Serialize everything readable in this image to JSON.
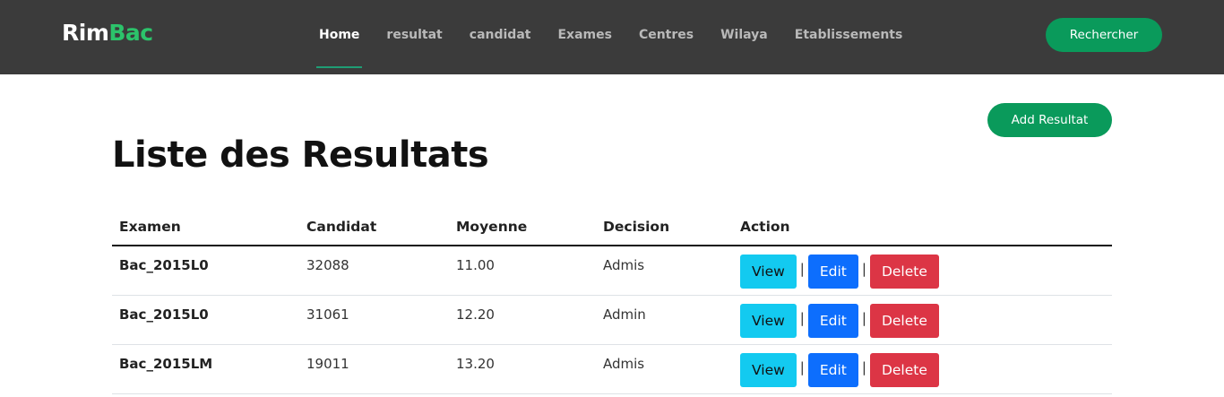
{
  "brand": {
    "part1": "Rim",
    "part2": "Bac"
  },
  "nav": {
    "items": [
      {
        "label": "Home",
        "active": true
      },
      {
        "label": "resultat"
      },
      {
        "label": "candidat"
      },
      {
        "label": "Exames"
      },
      {
        "label": "Centres"
      },
      {
        "label": "Wilaya"
      },
      {
        "label": "Etablissements"
      }
    ],
    "search_label": "Rechercher"
  },
  "main": {
    "add_label": "Add Resultat",
    "title": "Liste des Resultats",
    "table": {
      "headers": [
        "Examen",
        "Candidat",
        "Moyenne",
        "Decision",
        "Action"
      ],
      "rows": [
        {
          "examen": "Bac_2015L0",
          "candidat": "32088",
          "moyenne": "11.00",
          "decision": "Admis"
        },
        {
          "examen": "Bac_2015L0",
          "candidat": "31061",
          "moyenne": "12.20",
          "decision": "Admin"
        },
        {
          "examen": "Bac_2015LM",
          "candidat": "19011",
          "moyenne": "13.20",
          "decision": "Admis"
        }
      ],
      "actions": {
        "view": "View",
        "edit": "Edit",
        "delete": "Delete",
        "separator": "|"
      }
    }
  },
  "colors": {
    "navbar": "#3b3b3b",
    "brand_accent": "#2cc36b",
    "primary_green": "#0a9a5b",
    "view": "#13caf0",
    "edit": "#0d6efd",
    "delete": "#dc3545"
  }
}
